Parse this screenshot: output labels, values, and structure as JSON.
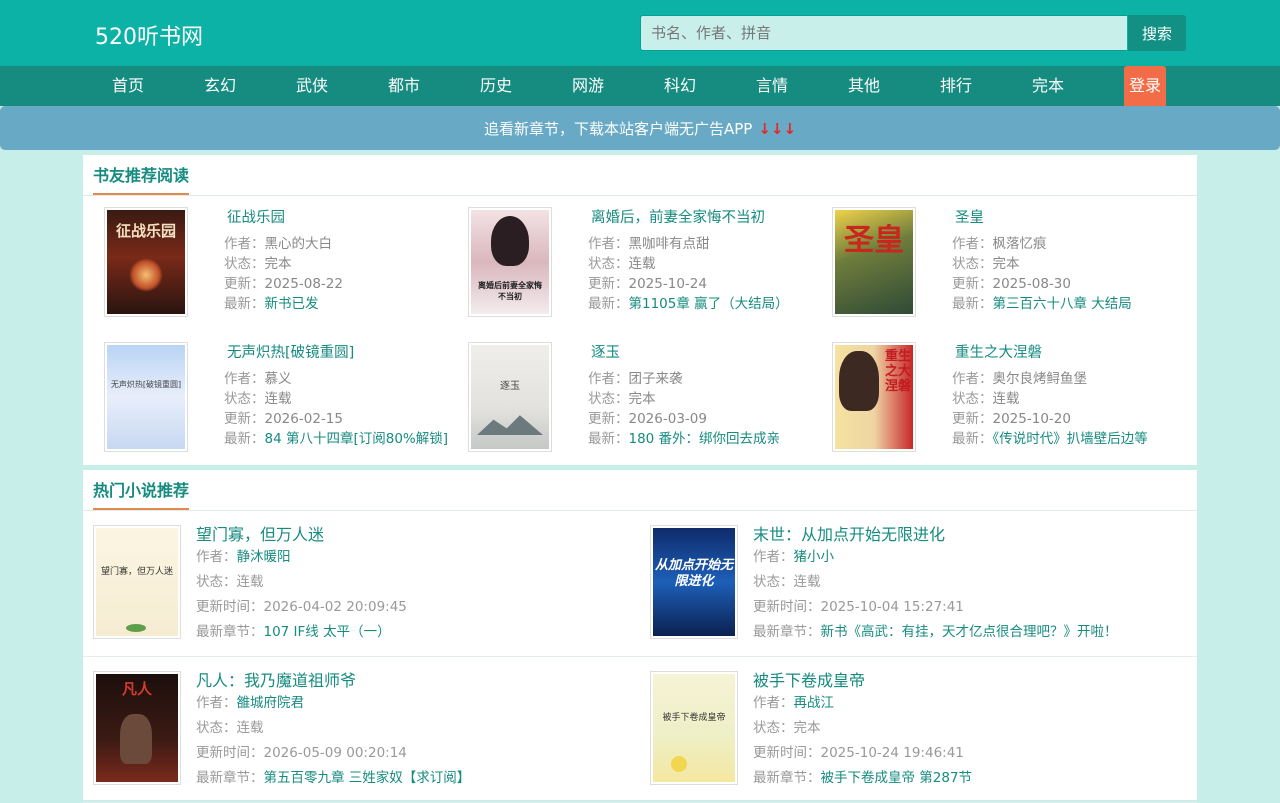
{
  "header": {
    "logo": "520听书网",
    "search_placeholder": "书名、作者、拼音",
    "search_button": "搜索"
  },
  "nav": {
    "items": [
      "首页",
      "玄幻",
      "武侠",
      "都市",
      "历史",
      "网游",
      "科幻",
      "言情",
      "其他",
      "排行",
      "完本"
    ],
    "login": "登录"
  },
  "banner": {
    "text": "追看新章节，下载本站客户端无广告APP",
    "arrows": "↓↓↓"
  },
  "labels": {
    "author": "作者：",
    "status": "状态：",
    "updated": "更新：",
    "latest": "最新：",
    "updated_time": "更新时间：",
    "latest_chapter": "最新章节："
  },
  "recommend": {
    "title": "书友推荐阅读",
    "books": [
      {
        "title": "征战乐园",
        "author": "黑心的大白",
        "status": "完本",
        "updated": "2025-08-22",
        "latest": "新书已发",
        "cover_text": "征战乐园"
      },
      {
        "title": "离婚后，前妻全家悔不当初",
        "author": "黑咖啡有点甜",
        "status": "连载",
        "updated": "2025-10-24",
        "latest": "第1105章 赢了（大结局）",
        "cover_text": "离婚后前妻全家悔不当初"
      },
      {
        "title": "圣皇",
        "author": "枫落忆痕",
        "status": "完本",
        "updated": "2025-08-30",
        "latest": "第三百六十八章 大结局",
        "cover_text": "圣皇"
      },
      {
        "title": "无声炽热[破镜重圆]",
        "author": "慕义",
        "status": "连载",
        "updated": "2026-02-15",
        "latest": "84 第八十四章[订阅80%解锁]",
        "cover_text": "无声炽热[破镜重圆]"
      },
      {
        "title": "逐玉",
        "author": "团子来袭",
        "status": "完本",
        "updated": "2026-03-09",
        "latest": "180 番外：绑你回去成亲",
        "cover_text": "逐玉"
      },
      {
        "title": "重生之大涅磐",
        "author": "奥尔良烤鲟鱼堡",
        "status": "连载",
        "updated": "2025-10-20",
        "latest": "《传说时代》扒墙壁后边等",
        "cover_text": "重生之大涅磐"
      }
    ]
  },
  "hot": {
    "title": "热门小说推荐",
    "books": [
      {
        "title": "望门寡，但万人迷",
        "author": "静沐暖阳",
        "status": "连载",
        "updated_time": "2026-04-02 20:09:45",
        "latest_chapter": "107 IF线 太平（一）",
        "cover_text": "望门寡，但万人迷"
      },
      {
        "title": "末世：从加点开始无限进化",
        "author": "猪小小",
        "status": "连载",
        "updated_time": "2025-10-04 15:27:41",
        "latest_chapter": "新书《高武：有挂，天才亿点很合理吧？》开啦！",
        "cover_text": "从加点开始无限进化"
      },
      {
        "title": "凡人：我乃魔道祖师爷",
        "author": "雒城府院君",
        "status": "连载",
        "updated_time": "2026-05-09 00:20:14",
        "latest_chapter": "第五百零九章 三姓家奴【求订阅】",
        "cover_text": "凡人"
      },
      {
        "title": "被手下卷成皇帝",
        "author": "再战江",
        "status": "完本",
        "updated_time": "2025-10-24 19:46:41",
        "latest_chapter": "被手下卷成皇帝 第287节",
        "cover_text": "被手下卷成皇帝"
      }
    ]
  },
  "colors": {
    "primary": "#0bb2a5",
    "nav": "#168b80",
    "login": "#f26c48",
    "banner": "#68aac5",
    "accent_underline": "#e1894e",
    "link": "#168b80"
  }
}
